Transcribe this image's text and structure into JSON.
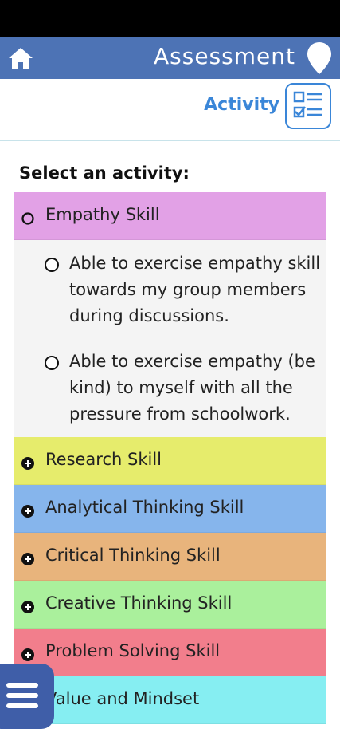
{
  "header": {
    "title": "Assessment",
    "bg_color": "#4d73b5",
    "home_icon": "home-icon",
    "location_icon": "location-pin-icon"
  },
  "subheader": {
    "activity_label": "Activity",
    "activity_icon": "checklist-icon"
  },
  "prompt": "Select an activity:",
  "categories": [
    {
      "label": "Empathy Skill",
      "color": "#e2a1e6",
      "state": "expanded",
      "items": [
        "Able to exercise empathy skill towards my group members during discussions.",
        "Able to exercise empathy (be kind) to myself with all the pressure from schoolwork."
      ]
    },
    {
      "label": "Research Skill",
      "color": "#e6ec6c",
      "state": "collapsed"
    },
    {
      "label": "Analytical Thinking Skill",
      "color": "#86b5ec",
      "state": "collapsed"
    },
    {
      "label": "Critical Thinking Skill",
      "color": "#e8b47c",
      "state": "collapsed"
    },
    {
      "label": "Creative Thinking Skill",
      "color": "#aaf09c",
      "state": "collapsed"
    },
    {
      "label": "Problem Solving Skill",
      "color": "#f27e8c",
      "state": "collapsed"
    },
    {
      "label": "Value and Mindset",
      "color": "#86eef2",
      "state": "collapsed"
    }
  ],
  "fab": {
    "icon": "menu-icon"
  }
}
